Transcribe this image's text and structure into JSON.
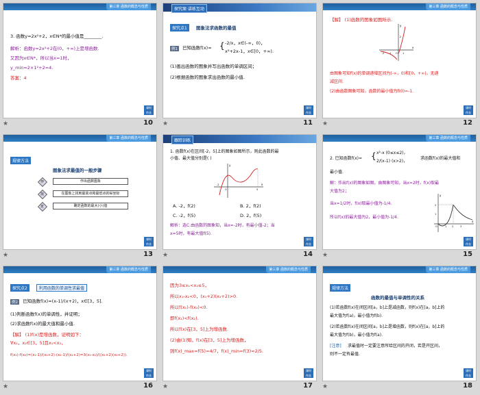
{
  "header_chapter": "第三章  函数的概念与性质",
  "star_mark": "★",
  "corner_label": "课时\n作业",
  "slides": [
    {
      "num": "10",
      "lines": [
        "3. 函数y=2x²+2，x∈N*的最小值是________.",
        "解析：函数y=2x²+2在(0，+∞)上是增函数.",
        "又因为x∈N*，所以当x=1时，",
        "y_min=2×1²+2=4.",
        "答案：4"
      ]
    },
    {
      "num": "11",
      "top_bar": "探究案·讲练互动",
      "top_cap": "探究案·讲练互动",
      "tag": "探究点1",
      "tag_title": "图象法求函数的最值",
      "example": "例1",
      "lines": [
        "已知函数f(x)=",
        "-2/x，x∈(-∞，0)，",
        "x²+2x-1，x∈[0，+∞).",
        "(1)画出函数的图象并写出函数的单调区间；",
        "(2)根据函数的图象求出函数的最小值."
      ]
    },
    {
      "num": "12",
      "lines": [
        "【解】 (1)函数的图象如图所示.",
        "由图象可知f(x)的单调递增区间为(-∞，0)和[0，+∞)，无递",
        "减区间.",
        "(2)由函数图象可知，函数的最小值为f(0)=-1."
      ],
      "graph_labels": [
        "y",
        "x",
        "-2",
        "-1",
        "O",
        "1",
        "2"
      ]
    },
    {
      "num": "13",
      "tag": "规律方法",
      "title": "图象法求最值的一般步骤",
      "steps": [
        "作",
        "找",
        "定"
      ],
      "boxes": [
        "作出函数图象",
        "在图象上找到最高点和最低点的纵坐标",
        "确定函数的最大(小)值"
      ]
    },
    {
      "num": "14",
      "top_bar": "跟踪训练",
      "lines": [
        "1. 函数f(x)在区间[-2，5]上的图象如图所示，则此函数的最",
        "小值、最大值分别是(    )",
        "A. -2，f(2)",
        "B. 2，f(2)",
        "C. -2，f(5)",
        "D. 2，f(5)",
        "解析：选C.由函数的图象知，当x=-2时，有最小值-2；当",
        "x=5时，有最大值f(5)."
      ],
      "graph_labels": [
        "y",
        "x",
        "-2",
        "O",
        "5"
      ]
    },
    {
      "num": "15",
      "lines": [
        "2. 已知函数f(x)=",
        "x²-x (0≤x≤2)，",
        "2/(x-1) (x>2)，",
        "求函数f(x)的最大值和",
        "最小值.",
        "解：作出f(x)的图象如图，由图象可知，当x=2时，f(x)取最",
        "大值为2；",
        "当x=1/2时，f(x)取最小值为-1/4.",
        "所以f(x)的最大值为2，最小值为-1/4."
      ],
      "graph_labels": [
        "y",
        "x",
        "2",
        "1",
        "O",
        "1",
        "2",
        "3"
      ]
    },
    {
      "num": "16",
      "tag": "探究点2",
      "tag_title": "利用函数的单调性求最值",
      "example": "例2",
      "lines": [
        "已知函数f(x)=(x-1)/(x+2)，x∈[3，5].",
        "(1)判断函数f(x)的单调性，并证明；",
        "(2)求函数f(x)的最大值和最小值.",
        "【解】 (1)f(x)是增函数，证明如下：",
        "∀x₁，x₂∈[3，5]且x₁<x₂，",
        "f(x₁)-f(x₂)=(x₁-1)/(x₁+2)-(x₂-1)/(x₂+2)=3(x₁-x₂)/((x₁+2)(x₂+2))."
      ]
    },
    {
      "num": "17",
      "lines": [
        "因为3≤x₁<x₂≤5，",
        "所以x₁-x₂<0，(x₁+2)(x₂+2)>0.",
        "所以f(x₁)-f(x₂)<0.",
        "即f(x₁)<f(x₂).",
        "所以f(x)在[3，5]上为增函数.",
        "(2)由(1)知，f(x)在[3，5]上为增函数，",
        "则f(x)_max=f(5)=4/7，f(x)_min=f(3)=2/5."
      ]
    },
    {
      "num": "18",
      "tag": "规律方法",
      "title": "函数的最值与单调性的关系",
      "lines": [
        "(1)若函数f(x)在闭区间[a，b]上是减函数，则f(x)在[a，b]上的",
        "最大值为f(a)，最小值为f(b).",
        "(2)若函数f(x)在闭区间[a，b]上是增函数，则f(x)在[a，b]上的",
        "最大值为f(b)，最小值为f(a).",
        "求最值时一定要注意所给区间的开闭，若是开区间，",
        "则不一定有最值."
      ],
      "note": "[注意]"
    }
  ]
}
